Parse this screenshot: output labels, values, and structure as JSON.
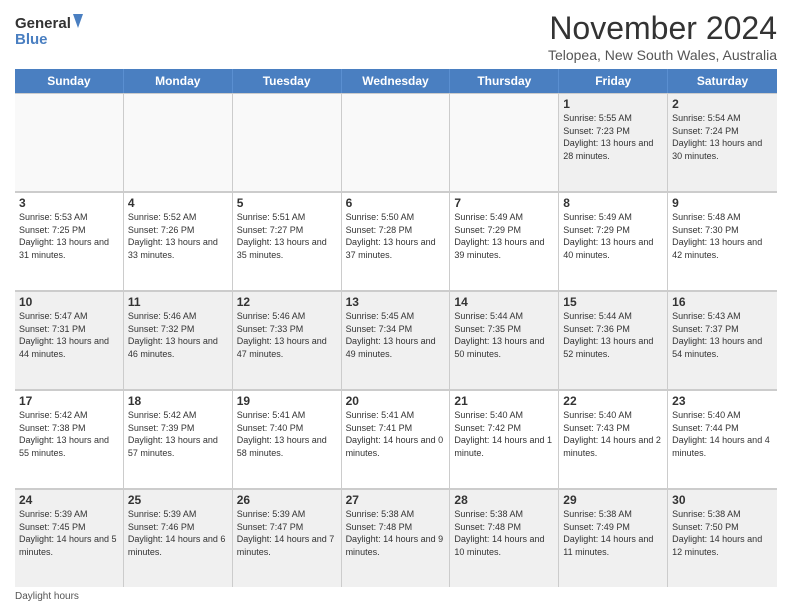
{
  "header": {
    "logo_line1": "General",
    "logo_line2": "Blue",
    "month": "November 2024",
    "location": "Telopea, New South Wales, Australia"
  },
  "days_of_week": [
    "Sunday",
    "Monday",
    "Tuesday",
    "Wednesday",
    "Thursday",
    "Friday",
    "Saturday"
  ],
  "weeks": [
    [
      {
        "day": "",
        "info": "",
        "empty": true
      },
      {
        "day": "",
        "info": "",
        "empty": true
      },
      {
        "day": "",
        "info": "",
        "empty": true
      },
      {
        "day": "",
        "info": "",
        "empty": true
      },
      {
        "day": "",
        "info": "",
        "empty": true
      },
      {
        "day": "1",
        "info": "Sunrise: 5:55 AM\nSunset: 7:23 PM\nDaylight: 13 hours and 28 minutes."
      },
      {
        "day": "2",
        "info": "Sunrise: 5:54 AM\nSunset: 7:24 PM\nDaylight: 13 hours and 30 minutes."
      }
    ],
    [
      {
        "day": "3",
        "info": "Sunrise: 5:53 AM\nSunset: 7:25 PM\nDaylight: 13 hours and 31 minutes."
      },
      {
        "day": "4",
        "info": "Sunrise: 5:52 AM\nSunset: 7:26 PM\nDaylight: 13 hours and 33 minutes."
      },
      {
        "day": "5",
        "info": "Sunrise: 5:51 AM\nSunset: 7:27 PM\nDaylight: 13 hours and 35 minutes."
      },
      {
        "day": "6",
        "info": "Sunrise: 5:50 AM\nSunset: 7:28 PM\nDaylight: 13 hours and 37 minutes."
      },
      {
        "day": "7",
        "info": "Sunrise: 5:49 AM\nSunset: 7:29 PM\nDaylight: 13 hours and 39 minutes."
      },
      {
        "day": "8",
        "info": "Sunrise: 5:49 AM\nSunset: 7:29 PM\nDaylight: 13 hours and 40 minutes."
      },
      {
        "day": "9",
        "info": "Sunrise: 5:48 AM\nSunset: 7:30 PM\nDaylight: 13 hours and 42 minutes."
      }
    ],
    [
      {
        "day": "10",
        "info": "Sunrise: 5:47 AM\nSunset: 7:31 PM\nDaylight: 13 hours and 44 minutes."
      },
      {
        "day": "11",
        "info": "Sunrise: 5:46 AM\nSunset: 7:32 PM\nDaylight: 13 hours and 46 minutes."
      },
      {
        "day": "12",
        "info": "Sunrise: 5:46 AM\nSunset: 7:33 PM\nDaylight: 13 hours and 47 minutes."
      },
      {
        "day": "13",
        "info": "Sunrise: 5:45 AM\nSunset: 7:34 PM\nDaylight: 13 hours and 49 minutes."
      },
      {
        "day": "14",
        "info": "Sunrise: 5:44 AM\nSunset: 7:35 PM\nDaylight: 13 hours and 50 minutes."
      },
      {
        "day": "15",
        "info": "Sunrise: 5:44 AM\nSunset: 7:36 PM\nDaylight: 13 hours and 52 minutes."
      },
      {
        "day": "16",
        "info": "Sunrise: 5:43 AM\nSunset: 7:37 PM\nDaylight: 13 hours and 54 minutes."
      }
    ],
    [
      {
        "day": "17",
        "info": "Sunrise: 5:42 AM\nSunset: 7:38 PM\nDaylight: 13 hours and 55 minutes."
      },
      {
        "day": "18",
        "info": "Sunrise: 5:42 AM\nSunset: 7:39 PM\nDaylight: 13 hours and 57 minutes."
      },
      {
        "day": "19",
        "info": "Sunrise: 5:41 AM\nSunset: 7:40 PM\nDaylight: 13 hours and 58 minutes."
      },
      {
        "day": "20",
        "info": "Sunrise: 5:41 AM\nSunset: 7:41 PM\nDaylight: 14 hours and 0 minutes."
      },
      {
        "day": "21",
        "info": "Sunrise: 5:40 AM\nSunset: 7:42 PM\nDaylight: 14 hours and 1 minute."
      },
      {
        "day": "22",
        "info": "Sunrise: 5:40 AM\nSunset: 7:43 PM\nDaylight: 14 hours and 2 minutes."
      },
      {
        "day": "23",
        "info": "Sunrise: 5:40 AM\nSunset: 7:44 PM\nDaylight: 14 hours and 4 minutes."
      }
    ],
    [
      {
        "day": "24",
        "info": "Sunrise: 5:39 AM\nSunset: 7:45 PM\nDaylight: 14 hours and 5 minutes."
      },
      {
        "day": "25",
        "info": "Sunrise: 5:39 AM\nSunset: 7:46 PM\nDaylight: 14 hours and 6 minutes."
      },
      {
        "day": "26",
        "info": "Sunrise: 5:39 AM\nSunset: 7:47 PM\nDaylight: 14 hours and 7 minutes."
      },
      {
        "day": "27",
        "info": "Sunrise: 5:38 AM\nSunset: 7:48 PM\nDaylight: 14 hours and 9 minutes."
      },
      {
        "day": "28",
        "info": "Sunrise: 5:38 AM\nSunset: 7:48 PM\nDaylight: 14 hours and 10 minutes."
      },
      {
        "day": "29",
        "info": "Sunrise: 5:38 AM\nSunset: 7:49 PM\nDaylight: 14 hours and 11 minutes."
      },
      {
        "day": "30",
        "info": "Sunrise: 5:38 AM\nSunset: 7:50 PM\nDaylight: 14 hours and 12 minutes."
      }
    ]
  ],
  "footer": {
    "daylight_label": "Daylight hours"
  }
}
